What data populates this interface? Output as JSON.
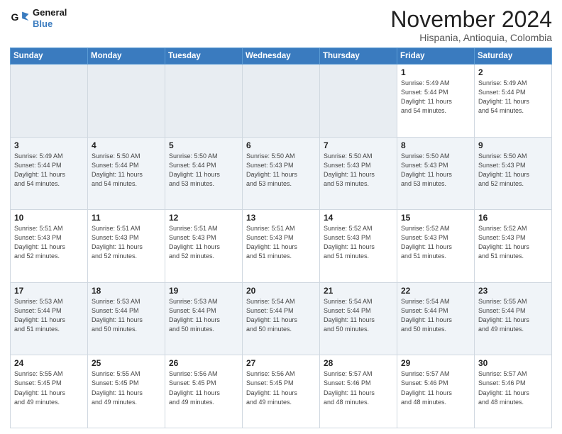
{
  "header": {
    "logo_line1": "General",
    "logo_line2": "Blue",
    "month_title": "November 2024",
    "location": "Hispania, Antioquia, Colombia"
  },
  "weekdays": [
    "Sunday",
    "Monday",
    "Tuesday",
    "Wednesday",
    "Thursday",
    "Friday",
    "Saturday"
  ],
  "weeks": [
    [
      {
        "day": "",
        "info": ""
      },
      {
        "day": "",
        "info": ""
      },
      {
        "day": "",
        "info": ""
      },
      {
        "day": "",
        "info": ""
      },
      {
        "day": "",
        "info": ""
      },
      {
        "day": "1",
        "info": "Sunrise: 5:49 AM\nSunset: 5:44 PM\nDaylight: 11 hours\nand 54 minutes."
      },
      {
        "day": "2",
        "info": "Sunrise: 5:49 AM\nSunset: 5:44 PM\nDaylight: 11 hours\nand 54 minutes."
      }
    ],
    [
      {
        "day": "3",
        "info": "Sunrise: 5:49 AM\nSunset: 5:44 PM\nDaylight: 11 hours\nand 54 minutes."
      },
      {
        "day": "4",
        "info": "Sunrise: 5:50 AM\nSunset: 5:44 PM\nDaylight: 11 hours\nand 54 minutes."
      },
      {
        "day": "5",
        "info": "Sunrise: 5:50 AM\nSunset: 5:44 PM\nDaylight: 11 hours\nand 53 minutes."
      },
      {
        "day": "6",
        "info": "Sunrise: 5:50 AM\nSunset: 5:43 PM\nDaylight: 11 hours\nand 53 minutes."
      },
      {
        "day": "7",
        "info": "Sunrise: 5:50 AM\nSunset: 5:43 PM\nDaylight: 11 hours\nand 53 minutes."
      },
      {
        "day": "8",
        "info": "Sunrise: 5:50 AM\nSunset: 5:43 PM\nDaylight: 11 hours\nand 53 minutes."
      },
      {
        "day": "9",
        "info": "Sunrise: 5:50 AM\nSunset: 5:43 PM\nDaylight: 11 hours\nand 52 minutes."
      }
    ],
    [
      {
        "day": "10",
        "info": "Sunrise: 5:51 AM\nSunset: 5:43 PM\nDaylight: 11 hours\nand 52 minutes."
      },
      {
        "day": "11",
        "info": "Sunrise: 5:51 AM\nSunset: 5:43 PM\nDaylight: 11 hours\nand 52 minutes."
      },
      {
        "day": "12",
        "info": "Sunrise: 5:51 AM\nSunset: 5:43 PM\nDaylight: 11 hours\nand 52 minutes."
      },
      {
        "day": "13",
        "info": "Sunrise: 5:51 AM\nSunset: 5:43 PM\nDaylight: 11 hours\nand 51 minutes."
      },
      {
        "day": "14",
        "info": "Sunrise: 5:52 AM\nSunset: 5:43 PM\nDaylight: 11 hours\nand 51 minutes."
      },
      {
        "day": "15",
        "info": "Sunrise: 5:52 AM\nSunset: 5:43 PM\nDaylight: 11 hours\nand 51 minutes."
      },
      {
        "day": "16",
        "info": "Sunrise: 5:52 AM\nSunset: 5:43 PM\nDaylight: 11 hours\nand 51 minutes."
      }
    ],
    [
      {
        "day": "17",
        "info": "Sunrise: 5:53 AM\nSunset: 5:44 PM\nDaylight: 11 hours\nand 51 minutes."
      },
      {
        "day": "18",
        "info": "Sunrise: 5:53 AM\nSunset: 5:44 PM\nDaylight: 11 hours\nand 50 minutes."
      },
      {
        "day": "19",
        "info": "Sunrise: 5:53 AM\nSunset: 5:44 PM\nDaylight: 11 hours\nand 50 minutes."
      },
      {
        "day": "20",
        "info": "Sunrise: 5:54 AM\nSunset: 5:44 PM\nDaylight: 11 hours\nand 50 minutes."
      },
      {
        "day": "21",
        "info": "Sunrise: 5:54 AM\nSunset: 5:44 PM\nDaylight: 11 hours\nand 50 minutes."
      },
      {
        "day": "22",
        "info": "Sunrise: 5:54 AM\nSunset: 5:44 PM\nDaylight: 11 hours\nand 50 minutes."
      },
      {
        "day": "23",
        "info": "Sunrise: 5:55 AM\nSunset: 5:44 PM\nDaylight: 11 hours\nand 49 minutes."
      }
    ],
    [
      {
        "day": "24",
        "info": "Sunrise: 5:55 AM\nSunset: 5:45 PM\nDaylight: 11 hours\nand 49 minutes."
      },
      {
        "day": "25",
        "info": "Sunrise: 5:55 AM\nSunset: 5:45 PM\nDaylight: 11 hours\nand 49 minutes."
      },
      {
        "day": "26",
        "info": "Sunrise: 5:56 AM\nSunset: 5:45 PM\nDaylight: 11 hours\nand 49 minutes."
      },
      {
        "day": "27",
        "info": "Sunrise: 5:56 AM\nSunset: 5:45 PM\nDaylight: 11 hours\nand 49 minutes."
      },
      {
        "day": "28",
        "info": "Sunrise: 5:57 AM\nSunset: 5:46 PM\nDaylight: 11 hours\nand 48 minutes."
      },
      {
        "day": "29",
        "info": "Sunrise: 5:57 AM\nSunset: 5:46 PM\nDaylight: 11 hours\nand 48 minutes."
      },
      {
        "day": "30",
        "info": "Sunrise: 5:57 AM\nSunset: 5:46 PM\nDaylight: 11 hours\nand 48 minutes."
      }
    ]
  ]
}
